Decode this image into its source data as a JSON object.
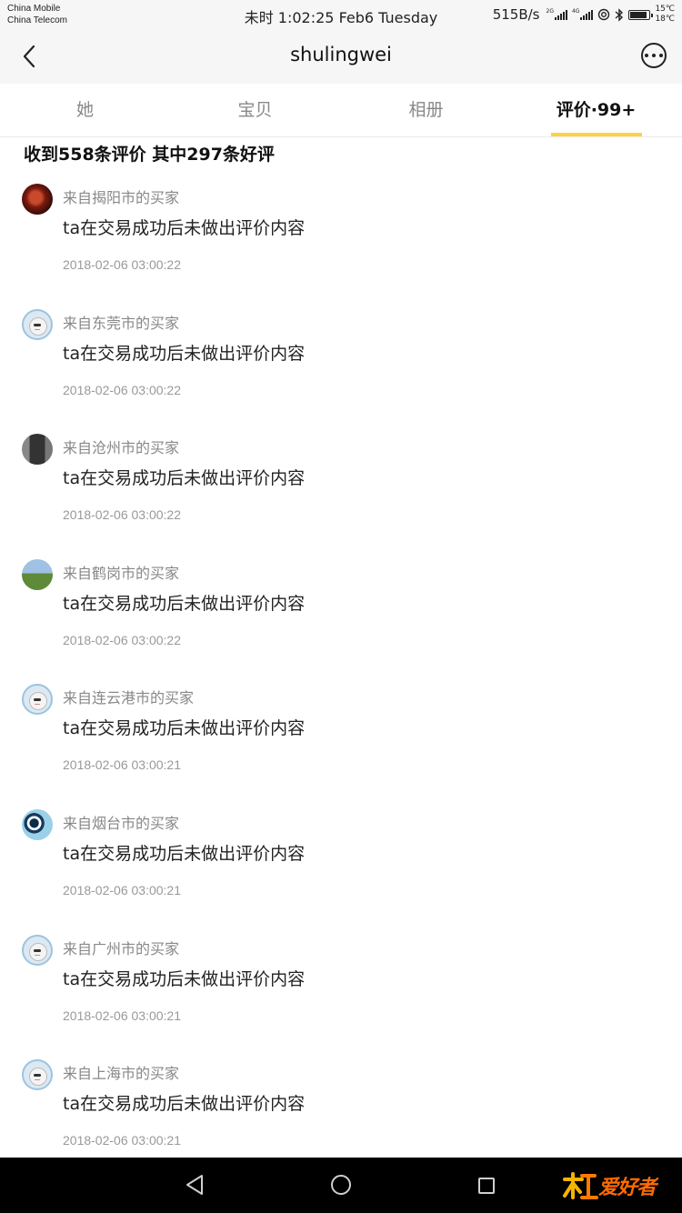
{
  "status_bar": {
    "carriers": [
      "China Mobile",
      "China Telecom"
    ],
    "time_text": "未时 1:02:25 Feb6 Tuesday",
    "net_speed": "515B/s",
    "signal_tags": [
      "2G",
      "4G"
    ],
    "battery_level_percent": 90,
    "temps": [
      "15℃",
      "18℃"
    ]
  },
  "nav": {
    "title": "shulingwei",
    "back_icon": "chevron-left-icon",
    "more_icon": "more-horizontal-icon"
  },
  "tabs": [
    {
      "label": "她",
      "active": false
    },
    {
      "label": "宝贝",
      "active": false
    },
    {
      "label": "相册",
      "active": false
    },
    {
      "label": "评价·99+",
      "active": true
    }
  ],
  "accent_color": "#ffd23f",
  "summary": "收到558条评价 其中297条好评",
  "reviews": [
    {
      "avatar": "photo-red-object",
      "buyer": "来自揭阳市的买家",
      "content": "ta在交易成功后未做出评价内容",
      "date": "2018-02-06 03:00:22"
    },
    {
      "avatar": "default-alpaca",
      "buyer": "来自东莞市的买家",
      "content": "ta在交易成功后未做出评价内容",
      "date": "2018-02-06 03:00:22"
    },
    {
      "avatar": "photo-dark-figure",
      "buyer": "来自沧州市的买家",
      "content": "ta在交易成功后未做出评价内容",
      "date": "2018-02-06 03:00:22"
    },
    {
      "avatar": "photo-field",
      "buyer": "来自鹤岗市的买家",
      "content": "ta在交易成功后未做出评价内容",
      "date": "2018-02-06 03:00:22"
    },
    {
      "avatar": "default-alpaca",
      "buyer": "来自连云港市的买家",
      "content": "ta在交易成功后未做出评价内容",
      "date": "2018-02-06 03:00:21"
    },
    {
      "avatar": "photo-globe",
      "buyer": "来自烟台市的买家",
      "content": "ta在交易成功后未做出评价内容",
      "date": "2018-02-06 03:00:21"
    },
    {
      "avatar": "default-alpaca",
      "buyer": "来自广州市的买家",
      "content": "ta在交易成功后未做出评价内容",
      "date": "2018-02-06 03:00:21"
    },
    {
      "avatar": "default-alpaca",
      "buyer": "来自上海市的买家",
      "content": "ta在交易成功后未做出评价内容",
      "date": "2018-02-06 03:00:21"
    }
  ],
  "system_nav": {
    "back_icon": "triangle-back-icon",
    "home_icon": "circle-home-icon",
    "recent_icon": "square-recents-icon"
  },
  "watermark": {
    "text": "爱好者"
  }
}
